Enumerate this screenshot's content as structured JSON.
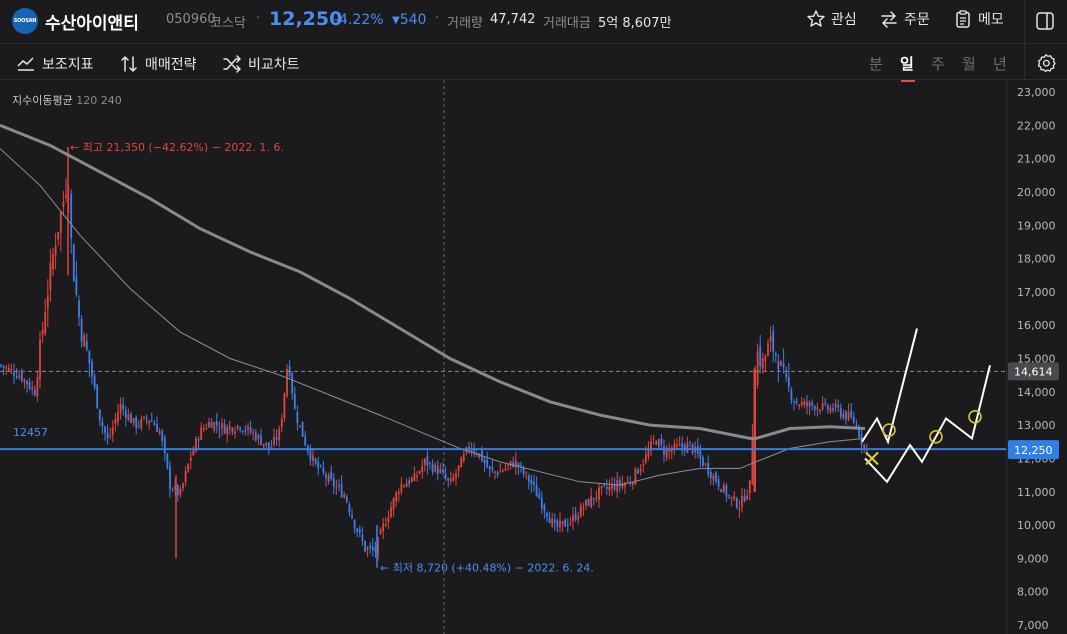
{
  "header": {
    "logo_text": "SOOSAN",
    "stock_name": "수산아이앤티",
    "stock_code": "050960",
    "market": "코스닥",
    "price": "12,250",
    "change_pct": "-4.22%",
    "change_abs": "540",
    "volume_label": "거래량",
    "volume_value": "47,742",
    "amount_label": "거래대금",
    "amount_value": "5억 8,607만",
    "buttons": {
      "watch": "관심",
      "order": "주문",
      "memo": "메모"
    }
  },
  "toolbar": {
    "indicators": "보조지표",
    "strategy": "매매전략",
    "compare": "비교차트",
    "periods": [
      "분",
      "일",
      "주",
      "월",
      "년"
    ],
    "active_period": "일"
  },
  "colors": {
    "up": "#e0453e",
    "down": "#3f7fe8",
    "price_line": "#2f7fe6",
    "background": "#1b1b1d"
  },
  "chart_data": {
    "type": "candlestick",
    "ma_label": "지수이동평균",
    "ma_periods": [
      "120",
      "240"
    ],
    "y_ticks": [
      "23,000",
      "22,000",
      "21,000",
      "20,000",
      "19,000",
      "18,000",
      "17,000",
      "16,000",
      "15,000",
      "14,000",
      "13,000",
      "12,000",
      "11,000",
      "10,000",
      "9,000",
      "8,000",
      "7,000"
    ],
    "ylim": [
      7000,
      23000
    ],
    "current_price_label": "12,250",
    "current_price": 12250,
    "crosshair_label": "14,614",
    "crosshair_price": 14614,
    "support_line_label": "12457",
    "support_line": 12457,
    "high_annotation": "← 최고 21,350 (−42.62%) − 2022. 1. 6.",
    "high_price": 21350,
    "low_annotation": "← 최저 8,720 (+40.48%) − 2022. 6. 24.",
    "low_price": 8720,
    "price_path": [
      [
        0,
        14800
      ],
      [
        20,
        14500
      ],
      [
        35,
        14000
      ],
      [
        45,
        16500
      ],
      [
        55,
        18500
      ],
      [
        62,
        19500
      ],
      [
        68,
        20500
      ],
      [
        72,
        18000
      ],
      [
        80,
        16000
      ],
      [
        90,
        14800
      ],
      [
        100,
        13200
      ],
      [
        108,
        12500
      ],
      [
        120,
        13600
      ],
      [
        135,
        13000
      ],
      [
        150,
        13200
      ],
      [
        160,
        12800
      ],
      [
        170,
        11200
      ],
      [
        180,
        10900
      ],
      [
        190,
        12000
      ],
      [
        200,
        12800
      ],
      [
        210,
        13100
      ],
      [
        225,
        12900
      ],
      [
        240,
        13000
      ],
      [
        255,
        12700
      ],
      [
        270,
        12300
      ],
      [
        280,
        12800
      ],
      [
        288,
        15000
      ],
      [
        295,
        13400
      ],
      [
        305,
        12500
      ],
      [
        315,
        11800
      ],
      [
        330,
        11300
      ],
      [
        345,
        10900
      ],
      [
        355,
        10000
      ],
      [
        365,
        9300
      ],
      [
        375,
        9200
      ],
      [
        385,
        10100
      ],
      [
        400,
        11200
      ],
      [
        415,
        11400
      ],
      [
        425,
        11900
      ],
      [
        440,
        11600
      ],
      [
        450,
        11200
      ],
      [
        460,
        11800
      ],
      [
        470,
        12400
      ],
      [
        480,
        12100
      ],
      [
        490,
        11600
      ],
      [
        500,
        11600
      ],
      [
        515,
        11900
      ],
      [
        530,
        11300
      ],
      [
        545,
        10500
      ],
      [
        555,
        9900
      ],
      [
        570,
        10100
      ],
      [
        585,
        10600
      ],
      [
        600,
        11000
      ],
      [
        615,
        11200
      ],
      [
        630,
        11300
      ],
      [
        645,
        12000
      ],
      [
        655,
        12600
      ],
      [
        665,
        12200
      ],
      [
        675,
        12300
      ],
      [
        690,
        12400
      ],
      [
        705,
        11800
      ],
      [
        720,
        11200
      ],
      [
        730,
        10800
      ],
      [
        740,
        10600
      ],
      [
        750,
        11200
      ],
      [
        756,
        15300
      ],
      [
        762,
        14800
      ],
      [
        770,
        15500
      ],
      [
        778,
        15000
      ],
      [
        786,
        14200
      ],
      [
        795,
        13700
      ],
      [
        805,
        13600
      ],
      [
        815,
        13600
      ],
      [
        825,
        13500
      ],
      [
        835,
        13500
      ],
      [
        845,
        13300
      ],
      [
        855,
        13100
      ],
      [
        862,
        12500
      ],
      [
        867,
        12250
      ]
    ],
    "ema120_path": [
      [
        0,
        21300
      ],
      [
        40,
        20200
      ],
      [
        80,
        18700
      ],
      [
        130,
        17100
      ],
      [
        180,
        15800
      ],
      [
        230,
        15000
      ],
      [
        280,
        14500
      ],
      [
        330,
        13900
      ],
      [
        380,
        13300
      ],
      [
        420,
        12800
      ],
      [
        460,
        12300
      ],
      [
        500,
        11900
      ],
      [
        540,
        11600
      ],
      [
        580,
        11300
      ],
      [
        620,
        11200
      ],
      [
        660,
        11500
      ],
      [
        700,
        11700
      ],
      [
        740,
        11700
      ],
      [
        756,
        11900
      ],
      [
        790,
        12300
      ],
      [
        830,
        12500
      ],
      [
        865,
        12600
      ]
    ],
    "ema240_path": [
      [
        0,
        22000
      ],
      [
        50,
        21400
      ],
      [
        100,
        20600
      ],
      [
        150,
        19800
      ],
      [
        200,
        18900
      ],
      [
        250,
        18200
      ],
      [
        300,
        17600
      ],
      [
        350,
        16800
      ],
      [
        400,
        15900
      ],
      [
        450,
        15000
      ],
      [
        500,
        14300
      ],
      [
        550,
        13700
      ],
      [
        600,
        13300
      ],
      [
        650,
        13000
      ],
      [
        700,
        12900
      ],
      [
        750,
        12600
      ],
      [
        756,
        12600
      ],
      [
        790,
        12900
      ],
      [
        830,
        12950
      ],
      [
        865,
        12900
      ]
    ],
    "projection_path": [
      [
        862,
        12500
      ],
      [
        877,
        13200
      ],
      [
        888,
        12500
      ],
      [
        917,
        15900
      ]
    ],
    "projection_path2": [
      [
        865,
        12000
      ],
      [
        887,
        11300
      ],
      [
        910,
        12400
      ],
      [
        922,
        11900
      ],
      [
        946,
        13200
      ],
      [
        972,
        12600
      ],
      [
        990,
        14800
      ]
    ],
    "markers": {
      "x_marker": {
        "x": 872,
        "price": 12000
      },
      "circles": [
        {
          "x": 889,
          "price": 12850
        },
        {
          "x": 936,
          "price": 12650
        },
        {
          "x": 975,
          "price": 13250
        }
      ]
    }
  }
}
